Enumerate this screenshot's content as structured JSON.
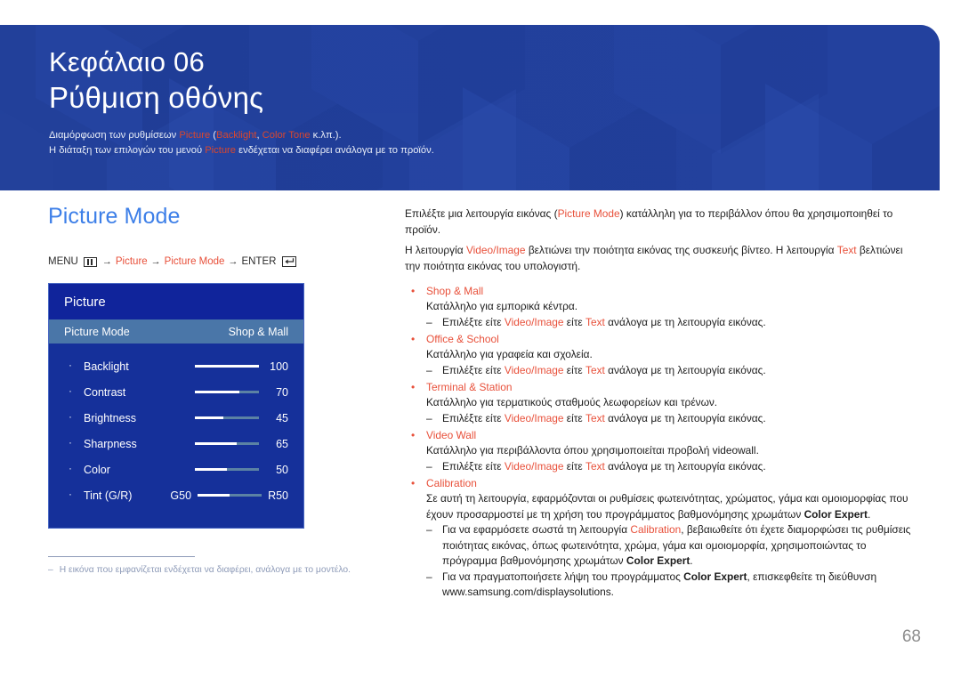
{
  "banner": {
    "chapter_line1": "Κεφάλαιο 06",
    "chapter_line2": "Ρύθμιση οθόνης",
    "sub1_a": "Διαμόρφωση των ρυθμίσεων ",
    "sub1_b": "Picture",
    "sub1_c": " (",
    "sub1_d": "Backlight",
    "sub1_e": ", ",
    "sub1_f": "Color Tone",
    "sub1_g": " κ.λπ.).",
    "sub2_a": "Η διάταξη των επιλογών του μενού ",
    "sub2_b": "Picture",
    "sub2_c": " ενδέχεται να διαφέρει ανάλογα με το προϊόν."
  },
  "left": {
    "section_title": "Picture Mode",
    "menu_path": {
      "menu_label": "MENU",
      "menu_icon": "menu-grid-icon",
      "arrow1": "→",
      "item1": "Picture",
      "arrow2": "→",
      "item2": "Picture Mode",
      "arrow3": "→",
      "enter_label": "ENTER",
      "enter_icon": "enter-return-icon"
    },
    "osd": {
      "title": "Picture",
      "selected_row": {
        "label": "Picture Mode",
        "value": "Shop & Mall"
      },
      "items": [
        {
          "label": "Backlight",
          "value": "100",
          "fill_pct": 100,
          "left_label": "",
          "right_label": ""
        },
        {
          "label": "Contrast",
          "value": "70",
          "fill_pct": 70,
          "left_label": "",
          "right_label": ""
        },
        {
          "label": "Brightness",
          "value": "45",
          "fill_pct": 45,
          "left_label": "",
          "right_label": ""
        },
        {
          "label": "Sharpness",
          "value": "65",
          "fill_pct": 65,
          "left_label": "",
          "right_label": ""
        },
        {
          "label": "Color",
          "value": "50",
          "fill_pct": 50,
          "left_label": "",
          "right_label": ""
        },
        {
          "label": "Tint (G/R)",
          "value": "",
          "fill_pct": 50,
          "left_label": "G50",
          "right_label": "R50"
        }
      ]
    }
  },
  "footnote": {
    "dash": "‒",
    "text": "Η εικόνα που εμφανίζεται ενδέχεται να διαφέρει, ανάλογα με το μοντέλο."
  },
  "right": {
    "p1_a": "Επιλέξτε μια λειτουργία εικόνας (",
    "p1_b": "Picture Mode",
    "p1_c": ") κατάλληλη για το περιβάλλον όπου θα χρησιμοποιηθεί το προϊόν.",
    "p2_a": "Η λειτουργία ",
    "p2_b": "Video/Image",
    "p2_c": " βελτιώνει την ποιότητα εικόνας της συσκευής βίντεο. Η λειτουργία ",
    "p2_d": "Text",
    "p2_e": " βελτιώνει την ποιότητα εικόνας του υπολογιστή.",
    "bullet_char": "•",
    "dash_char": "‒",
    "sub_a": "Επιλέξτε είτε ",
    "sub_b": "Video/Image",
    "sub_c": " είτε ",
    "sub_d": "Text",
    "sub_e": " ανάλογα με τη λειτουργία εικόνας.",
    "items": [
      {
        "title": "Shop & Mall",
        "desc": "Κατάλληλο για εμπορικά κέντρα."
      },
      {
        "title": "Office & School",
        "desc": "Κατάλληλο για γραφεία και σχολεία."
      },
      {
        "title": "Terminal & Station",
        "desc": "Κατάλληλο για τερματικούς σταθμούς λεωφορείων και τρένων."
      },
      {
        "title": "Video Wall",
        "desc": "Κατάλληλο για περιβάλλοντα όπου χρησιμοποιείται προβολή videowall."
      }
    ],
    "calibration": {
      "title": "Calibration",
      "desc_a": "Σε αυτή τη λειτουργία, εφαρμόζονται οι ρυθμίσεις φωτεινότητας, χρώματος, γάμα και ομοιομορφίας που έχουν προσαρμοστεί με τη χρήση του προγράμματος βαθμονόμησης χρωμάτων ",
      "desc_b": "Color Expert",
      "desc_c": ".",
      "sub1_a": "Για να εφαρμόσετε σωστά τη λειτουργία ",
      "sub1_b": "Calibration",
      "sub1_c": ", βεβαιωθείτε ότι έχετε διαμορφώσει τις ρυθμίσεις ποιότητας εικόνας, όπως φωτεινότητα, χρώμα, γάμα και ομοιομορφία, χρησιμοποιώντας το πρόγραμμα βαθμονόμησης χρωμάτων ",
      "sub1_d": "Color Expert",
      "sub1_e": ".",
      "sub2_a": "Για να πραγματοποιήσετε λήψη του προγράμματος ",
      "sub2_b": "Color Expert",
      "sub2_c": ", επισκεφθείτε τη διεύθυνση www.samsung.com/displaysolutions."
    }
  },
  "page_number": "68",
  "colors": {
    "banner_bg": "#22409a",
    "accent_blue": "#3d7fe8",
    "accent_red": "#e8503a",
    "osd_bg": "#15309a",
    "osd_title_bg": "#10249b",
    "osd_selected_bg": "#4a76a8",
    "footnote_gray": "#8e9bb8",
    "page_number_gray": "#8d8d8d"
  }
}
